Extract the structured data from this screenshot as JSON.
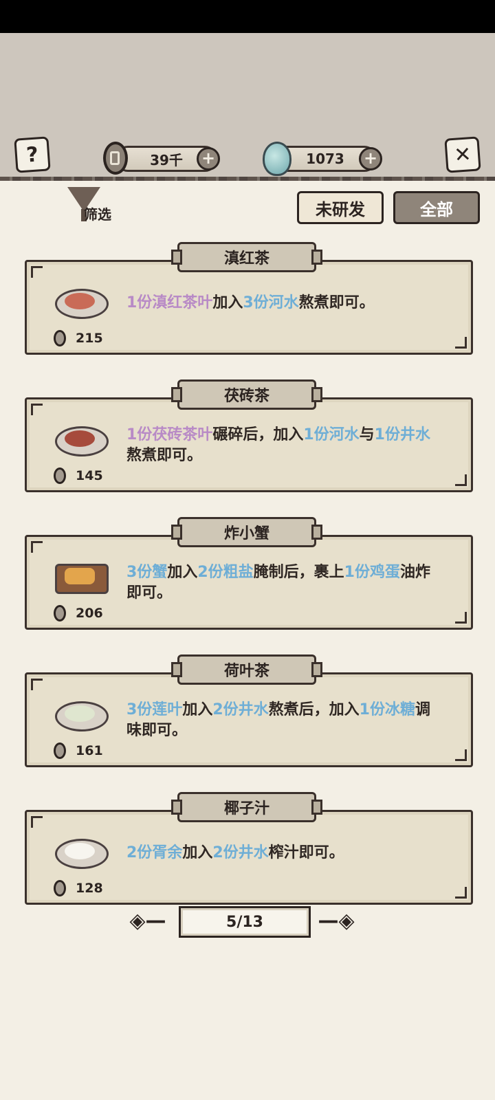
{
  "header": {
    "coins": "39千",
    "gems": "1073",
    "help_icon": "question-mark-icon",
    "close_icon": "x-close-icon",
    "plus_icon": "plus-icon"
  },
  "toolbar": {
    "filter_label": "筛选",
    "tab_unresearched": "未研发",
    "tab_all": "全部"
  },
  "recipes": [
    {
      "title": "滇红茶",
      "price": "215",
      "desc": [
        [
          "1份滇红茶叶",
          "purple"
        ],
        [
          "加入",
          ""
        ],
        [
          "3份河水",
          "blue"
        ],
        [
          "熬煮即可。",
          ""
        ]
      ]
    },
    {
      "title": "茯砖茶",
      "price": "145",
      "desc": [
        [
          "1份茯砖茶叶",
          "purple"
        ],
        [
          "碾碎后，加入",
          ""
        ],
        [
          "1份河水",
          "blue"
        ],
        [
          "与",
          ""
        ],
        [
          "1份井水",
          "blue"
        ],
        [
          "熬煮即可。",
          ""
        ]
      ]
    },
    {
      "title": "炸小蟹",
      "price": "206",
      "desc": [
        [
          "3份蟹",
          "blue"
        ],
        [
          "加入",
          ""
        ],
        [
          "2份粗盐",
          "blue"
        ],
        [
          "腌制后，裹上",
          ""
        ],
        [
          "1份鸡蛋",
          "blue"
        ],
        [
          "油炸即可。",
          ""
        ]
      ]
    },
    {
      "title": "荷叶茶",
      "price": "161",
      "desc": [
        [
          "3份莲叶",
          "blue"
        ],
        [
          "加入",
          ""
        ],
        [
          "2份井水",
          "blue"
        ],
        [
          "熬煮后，加入",
          ""
        ],
        [
          "1份冰糖",
          "blue"
        ],
        [
          "调味即可。",
          ""
        ]
      ]
    },
    {
      "title": "椰子汁",
      "price": "128",
      "desc": [
        [
          "2份胥余",
          "blue"
        ],
        [
          "加入",
          ""
        ],
        [
          "2份井水",
          "blue"
        ],
        [
          "榨汁即可。",
          ""
        ]
      ]
    }
  ],
  "pagination": {
    "page": "5/13"
  }
}
